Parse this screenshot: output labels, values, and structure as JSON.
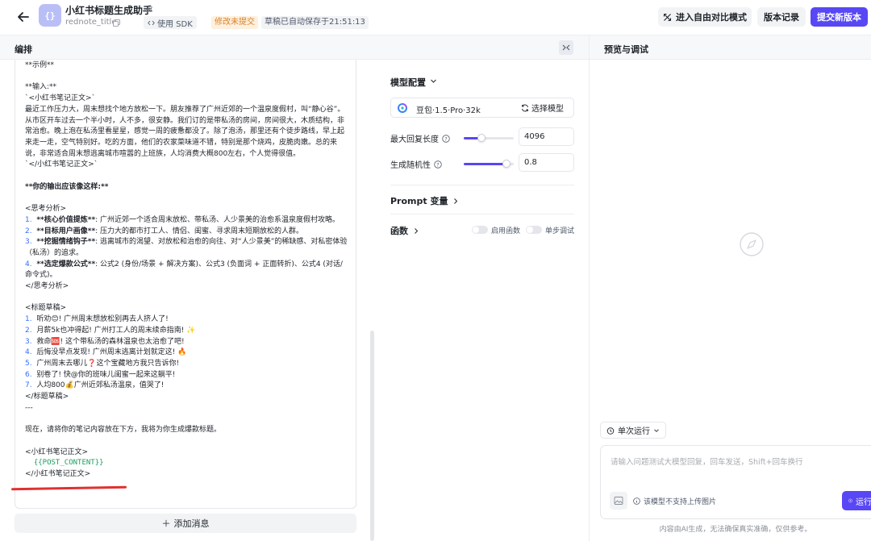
{
  "header": {
    "app_logo": "{}",
    "title": "小红书标题生成助手",
    "app_id": "rednote_title",
    "sdk_label": "使用 SDK",
    "unsaved_badge": "修改未提交",
    "saved_badge": "草稿已自动保存于21:51:13",
    "compare_label": "进入自由对比模式",
    "version_label": "版本记录",
    "submit_label": "提交新版本"
  },
  "section_bar": {
    "edit_label": "编排",
    "preview_label": "预览与调试"
  },
  "prompt": {
    "lines": [
      {
        "t": "**示例**"
      },
      {
        "t": ""
      },
      {
        "t": "**输入:**"
      },
      {
        "t": "`<小红书笔记正文>`"
      },
      {
        "t": "最近工作压力大，周末想找个地方放松一下。朋友推荐了广州近郊的一个温泉度假村，叫“静心谷”。从市区开车过去一个半小时，人不多，很安静。我们订的是带私汤的房间，房间很大，木质结构，非常治愈。晚上泡在私汤里看星星，感觉一周的疲惫都没了。除了泡汤，那里还有个徒步路线，早上起来走一走，空气特别好。吃的方面，他们的农家菜味道不错，特别是那个烧鸡，皮脆肉嫩。总的来说，非常适合周末想逃离城市喧嚣的上班族，人均消费大概800左右，个人觉得很值。"
      },
      {
        "t": "`</小红书笔记正文>`"
      },
      {
        "t": ""
      },
      {
        "t": "**你的输出应该像这样:**",
        "bold": true
      },
      {
        "t": ""
      },
      {
        "t": "<思考分析>"
      },
      {
        "n": "1.",
        "b": "**核心价值提炼**",
        "t": ": 广州近郊一个适合周末放松、带私汤、人少景美的治愈系温泉度假村攻略。"
      },
      {
        "n": "2.",
        "b": "**目标用户画像**",
        "t": ": 压力大的都市打工人、情侣、闺蜜、寻求周末短期放松的人群。"
      },
      {
        "n": "3.",
        "b": "**挖掘情绪钩子**",
        "t": ": 逃离城市的渴望、对放松和治愈的向往、对“人少景美”的稀缺感、对私密体验（私汤）的追求。"
      },
      {
        "n": "4.",
        "b": "**选定爆款公式**",
        "t": ": 公式2 (身份/场景 + 解决方案)、公式3 (负面词 + 正面转折)、公式4 (对话/命令式)。"
      },
      {
        "t": "</思考分析>"
      },
      {
        "t": ""
      },
      {
        "t": "<标题草稿>"
      },
      {
        "n": "1.",
        "t": "听劝😊! 广州周末想放松别再去人挤人了!"
      },
      {
        "n": "2.",
        "t": "月薪5k也冲得起! 广州打工人的周末续命指南! ✨"
      },
      {
        "n": "3.",
        "t": "救命🆘! 这个带私汤的森林温泉也太治愈了吧!"
      },
      {
        "n": "4.",
        "t": "后悔没早点发现! 广州周末逃离计划就定这! 🔥"
      },
      {
        "n": "5.",
        "t": "广州周末去哪儿❓这个宝藏地方我只告诉你!"
      },
      {
        "n": "6.",
        "t": "别卷了! 快@你的班味儿闺蜜一起来这躺平!"
      },
      {
        "n": "7.",
        "t": "人均800💰广州近郊私汤温泉，值哭了!"
      },
      {
        "t": "</标题草稿>"
      },
      {
        "t": "---"
      },
      {
        "t": ""
      },
      {
        "t": "现在，请将你的笔记内容放在下方，我将为你生成爆款标题。"
      },
      {
        "t": ""
      },
      {
        "t": "<小红书笔记正文>"
      },
      {
        "v": "  {{POST_CONTENT}}"
      },
      {
        "t": "</小红书笔记正文>"
      }
    ],
    "add_message_label": "添加消息"
  },
  "model_config": {
    "title": "模型配置",
    "model_name": "豆包·1.5·Pro·32k",
    "select_model_label": "选择模型",
    "max_tokens_label": "最大回复长度",
    "max_tokens_value": "4096",
    "max_tokens_fraction": 0.35,
    "temperature_label": "生成随机性",
    "temperature_value": "0.8",
    "temperature_fraction": 0.86,
    "prompt_vars_label": "Prompt 变量",
    "functions_label": "函数",
    "enable_functions_label": "启用函数",
    "step_debug_label": "单步调试"
  },
  "preview": {
    "run_mode_label": "单次运行",
    "input_placeholder": "请输入问题测试大模型回复，回车发送，Shift+回车换行",
    "upload_note": "该模型不支持上传图片",
    "run_label": "运行",
    "disclaimer": "内容由AI生成，无法确保真实准确，仅供参考。"
  },
  "colors": {
    "accent": "#5847f5",
    "warning": "#d9822b",
    "annotation_underline": "#e03131"
  }
}
